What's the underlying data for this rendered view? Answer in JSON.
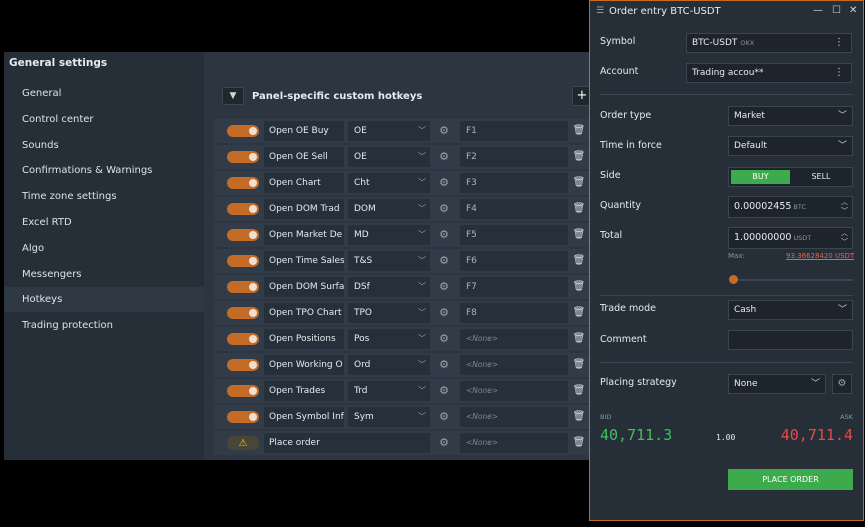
{
  "general_settings": {
    "title": "General settings",
    "nav": [
      {
        "label": "General"
      },
      {
        "label": "Control center"
      },
      {
        "label": "Sounds"
      },
      {
        "label": "Confirmations & Warnings"
      },
      {
        "label": "Time zone settings"
      },
      {
        "label": "Excel RTD"
      },
      {
        "label": "Algo"
      },
      {
        "label": "Messengers"
      },
      {
        "label": "Hotkeys",
        "active": true
      },
      {
        "label": "Trading protection"
      }
    ],
    "section_title": "Panel-specific custom hotkeys",
    "add_label": "+",
    "hotkeys": [
      {
        "name": "Open OE Buy",
        "abbr": "OE",
        "key": "F1",
        "enabled": true
      },
      {
        "name": "Open OE Sell",
        "abbr": "OE",
        "key": "F2",
        "enabled": true
      },
      {
        "name": "Open Chart",
        "abbr": "Cht",
        "key": "F3",
        "enabled": true
      },
      {
        "name": "Open DOM Trad",
        "abbr": "DOM",
        "key": "F4",
        "enabled": true
      },
      {
        "name": "Open Market De",
        "abbr": "MD",
        "key": "F5",
        "enabled": true
      },
      {
        "name": "Open Time Sales",
        "abbr": "T&S",
        "key": "F6",
        "enabled": true
      },
      {
        "name": "Open DOM Surfa",
        "abbr": "DSf",
        "key": "F7",
        "enabled": true
      },
      {
        "name": "Open TPO Chart",
        "abbr": "TPO",
        "key": "F8",
        "enabled": true
      },
      {
        "name": "Open Positions",
        "abbr": "Pos",
        "key": "<None>",
        "enabled": true
      },
      {
        "name": "Open Working O",
        "abbr": "Ord",
        "key": "<None>",
        "enabled": true
      },
      {
        "name": "Open Trades",
        "abbr": "Trd",
        "key": "<None>",
        "enabled": true
      },
      {
        "name": "Open Symbol Inf",
        "abbr": "Sym",
        "key": "<None>",
        "enabled": true
      },
      {
        "name": "Place order",
        "abbr": "",
        "key": "<None>",
        "enabled": false,
        "warning": true
      }
    ]
  },
  "order_entry": {
    "title": "Order entry BTC-USDT",
    "symbol_label": "Symbol",
    "symbol_value": "BTC-USDT",
    "symbol_exchange": "OKX",
    "account_label": "Account",
    "account_value": "Trading accou**",
    "order_type_label": "Order type",
    "order_type_value": "Market",
    "tif_label": "Time in force",
    "tif_value": "Default",
    "side_label": "Side",
    "buy_label": "BUY",
    "sell_label": "SELL",
    "quantity_label": "Quantity",
    "quantity_value": "0.00002455",
    "quantity_unit": "BTC",
    "total_label": "Total",
    "total_value": "1.00000000",
    "total_unit": "USDT",
    "max_label": "Max:",
    "max_value": "93.36628420 USDT",
    "slider_fraction": 0.0,
    "trade_mode_label": "Trade mode",
    "trade_mode_value": "Cash",
    "comment_label": "Comment",
    "comment_value": "",
    "placing_strategy_label": "Placing strategy",
    "placing_strategy_value": "None",
    "bid_label": "BID",
    "ask_label": "ASK",
    "bid_value": "40,711.3",
    "ask_value": "40,711.4",
    "spread_value": "1.00",
    "place_order_label": "PLACE ORDER"
  },
  "colors": {
    "accent": "#c46b26",
    "buy": "#3daa4d",
    "bid": "#3fc161",
    "ask": "#e84a4a",
    "background": "#262e37"
  }
}
